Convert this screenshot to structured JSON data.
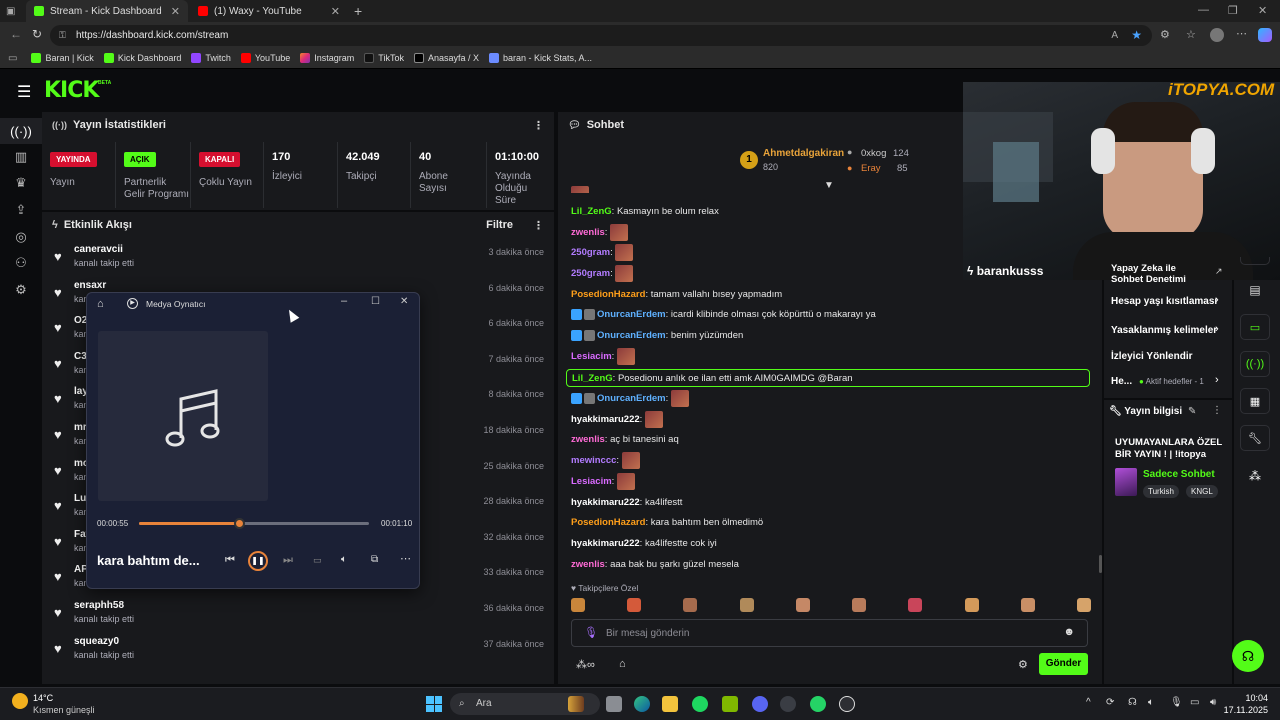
{
  "browser": {
    "tabs": [
      {
        "title": "Stream - Kick Dashboard"
      },
      {
        "title": "(1) Waxy - YouTube"
      }
    ],
    "url": "https://dashboard.kick.com/stream",
    "bookmarks": [
      "Baran | Kick",
      "Kick Dashboard",
      "Twitch",
      "YouTube",
      "Instagram",
      "TikTok",
      "Anasayfa / X",
      "baran - Kick Stats, A..."
    ]
  },
  "brand": {
    "logo": "KICK",
    "beta": "BETA",
    "color": "#53fc18"
  },
  "stats_panel": {
    "title": "Yayın İstatistikleri",
    "items": [
      {
        "badge": "YAYINDA",
        "badge_color": "#d60f2f",
        "label": "Yayın"
      },
      {
        "badge": "AÇIK",
        "badge_color": "#53fc18",
        "label": "Partnerlik Gelir Programı"
      },
      {
        "badge": "KAPALI",
        "badge_color": "#d60f2f",
        "label": "Çoklu Yayın"
      },
      {
        "value": "170",
        "label": "İzleyici"
      },
      {
        "value": "42.049",
        "label": "Takipçi"
      },
      {
        "value": "40",
        "label": "Abone Sayısı"
      },
      {
        "value": "01:10:00",
        "label": "Yayında Olduğu Süre"
      }
    ]
  },
  "activity": {
    "title": "Etkinlik Akışı",
    "filter": "Filtre",
    "items": [
      {
        "name": "caneravcii",
        "sub": "kanalı takip etti",
        "time": "3 dakika önce"
      },
      {
        "name": "ensaxr",
        "sub": "kanalı takip etti",
        "time": "6 dakika önce"
      },
      {
        "name": "O2",
        "sub": "kanalı takip etti",
        "time": "6 dakika önce"
      },
      {
        "name": "C3",
        "sub": "kanalı takip etti",
        "time": "7 dakika önce"
      },
      {
        "name": "lay",
        "sub": "kanalı takip etti",
        "time": "8 dakika önce"
      },
      {
        "name": "mr",
        "sub": "kanalı takip etti",
        "time": "18 dakika önce"
      },
      {
        "name": "mo",
        "sub": "kanalı takip etti",
        "time": "25 dakika önce"
      },
      {
        "name": "Lu",
        "sub": "kanalı takip etti",
        "time": "28 dakika önce"
      },
      {
        "name": "Fat",
        "sub": "kanalı takip etti",
        "time": "32 dakika önce"
      },
      {
        "name": "AP",
        "sub": "kanalı takip etti",
        "time": "33 dakika önce"
      },
      {
        "name": "seraphh58",
        "sub": "kanalı takip etti",
        "time": "36 dakika önce"
      },
      {
        "name": "squeazy0",
        "sub": "kanalı takip etti",
        "time": "37 dakika önce"
      }
    ]
  },
  "media_player": {
    "title": "Medya Oynatıcı",
    "elapsed": "00:00:55",
    "total": "00:01:10",
    "progress": 0.44,
    "track": "kara bahtım de..."
  },
  "chat": {
    "title": "Sohbet",
    "leaders": [
      {
        "rank": "1",
        "name": "Ahmetdalgakiran",
        "count": "820"
      },
      {
        "name": "0xkog",
        "count": "124"
      },
      {
        "name": "Eray",
        "count": "85"
      }
    ],
    "messages": [
      {
        "user": "Lil_ZenG",
        "color": "#53fc18",
        "text": "Kasmayın be olum relax"
      },
      {
        "user": "zwenlis",
        "color": "#ff6bd6",
        "text": "",
        "emote": true
      },
      {
        "user": "250gram",
        "color": "#b27cff",
        "text": "",
        "emote": true
      },
      {
        "user": "250gram",
        "color": "#b27cff",
        "text": "",
        "emote": true
      },
      {
        "user": "PosedionHazard",
        "color": "#ff9f1a",
        "text": "tamam vallahı bısey yapmadım"
      },
      {
        "user": "OnurcanErdem",
        "color": "#5fb1ff",
        "text": "icardi klibinde olması çok köpürttü o makarayı ya",
        "badges": true
      },
      {
        "user": "OnurcanErdem",
        "color": "#5fb1ff",
        "text": "benim yüzümden",
        "badges": true
      },
      {
        "user": "Lesiacim",
        "color": "#d96bff",
        "text": "",
        "emote": true
      },
      {
        "user": "Lil_ZenG",
        "color": "#53fc18",
        "text": "Posedionu anlık oe ilan etti amk AIM0GAIMDG @Baran",
        "highlight": true
      },
      {
        "user": "OnurcanErdem",
        "color": "#5fb1ff",
        "text": "",
        "emote": true,
        "badges": true
      },
      {
        "user": "hyakkimaru222",
        "color": "#ffffff",
        "text": "",
        "emote": true
      },
      {
        "user": "zwenlis",
        "color": "#ff6bd6",
        "text": "aç bi tanesini aq"
      },
      {
        "user": "mewinccc",
        "color": "#b27cff",
        "text": "",
        "emote": true
      },
      {
        "user": "Lesiacim",
        "color": "#d96bff",
        "text": "",
        "emote": true
      },
      {
        "user": "hyakkimaru222",
        "color": "#ffffff",
        "text": "ka4lifestt"
      },
      {
        "user": "PosedionHazard",
        "color": "#ff9f1a",
        "text": "kara bahtım ben ölmedimö"
      },
      {
        "user": "hyakkimaru222",
        "color": "#ffffff",
        "text": "ka4lifestte cok iyi"
      },
      {
        "user": "zwenlis",
        "color": "#ff6bd6",
        "text": "aaa bak bu şarkı güzel mesela"
      }
    ],
    "followers_only": "Takipçilere Özel",
    "input_placeholder": "Bir mesaj gönderin",
    "send": "Gönder"
  },
  "right_panel": {
    "links": [
      "Yapay Zeka ile Sohbet Denetimi",
      "Hesap yaşı kısıtlaması",
      "Yasaklanmış kelimeler",
      "İzleyici Yönlendir",
      "He...",
      "Aktif hedefler - 1"
    ],
    "info_title": "Yayın bilgisi",
    "stream_title": "UYUMAYANLARA ÖZEL BİR YAYIN ! | !itopya",
    "category": "Sadece Sohbet",
    "tags": [
      "Turkish",
      "KNGL"
    ]
  },
  "webcam": {
    "name": "barankusss",
    "overlay": "iTOPYA.COM"
  },
  "taskbar": {
    "weather_temp": "14°C",
    "weather_desc": "Kısmen güneşli",
    "search": "Ara",
    "time": "10:04",
    "date": "17.11.2025"
  }
}
